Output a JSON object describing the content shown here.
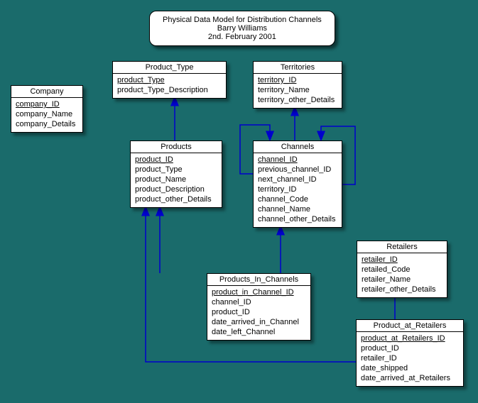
{
  "title": {
    "line1": "Physical Data Model for Distribution Channels",
    "line2": "Barry Williams",
    "line3": "2nd. February 2001"
  },
  "entities": {
    "company": {
      "name": "Company",
      "pk": "company_ID",
      "attrs": [
        "company_Name",
        "company_Details"
      ]
    },
    "product_type": {
      "name": "Product_Type",
      "pk": "product_Type",
      "attrs": [
        "product_Type_Description"
      ]
    },
    "territories": {
      "name": "Territories",
      "pk": "territory_ID",
      "attrs": [
        "territory_Name",
        "territory_other_Details"
      ]
    },
    "products": {
      "name": "Products",
      "pk": "product_ID",
      "attrs": [
        "product_Type",
        "product_Name",
        "product_Description",
        "product_other_Details"
      ]
    },
    "channels": {
      "name": "Channels",
      "pk": "channel_ID",
      "attrs": [
        "previous_channel_ID",
        "next_channel_ID",
        "territory_ID",
        "channel_Code",
        "channel_Name",
        "channel_other_Details"
      ]
    },
    "retailers": {
      "name": "Retailers",
      "pk": "retailer_ID",
      "attrs": [
        "retailed_Code",
        "retailer_Name",
        "retailer_other_Details"
      ]
    },
    "products_in_channels": {
      "name": "Products_In_Channels",
      "pk": "product_in_Channel_ID",
      "attrs": [
        "channel_ID",
        "product_ID",
        "date_arrived_in_Channel",
        "date_left_Channel"
      ]
    },
    "product_at_retailers": {
      "name": "Product_at_Retailers",
      "pk": "product_at_Retailers_ID",
      "attrs": [
        "product_ID",
        "retailer_ID",
        "date_shipped",
        "date_arrived_at_Retailers"
      ]
    }
  },
  "colors": {
    "arrow": "#0000CC"
  }
}
